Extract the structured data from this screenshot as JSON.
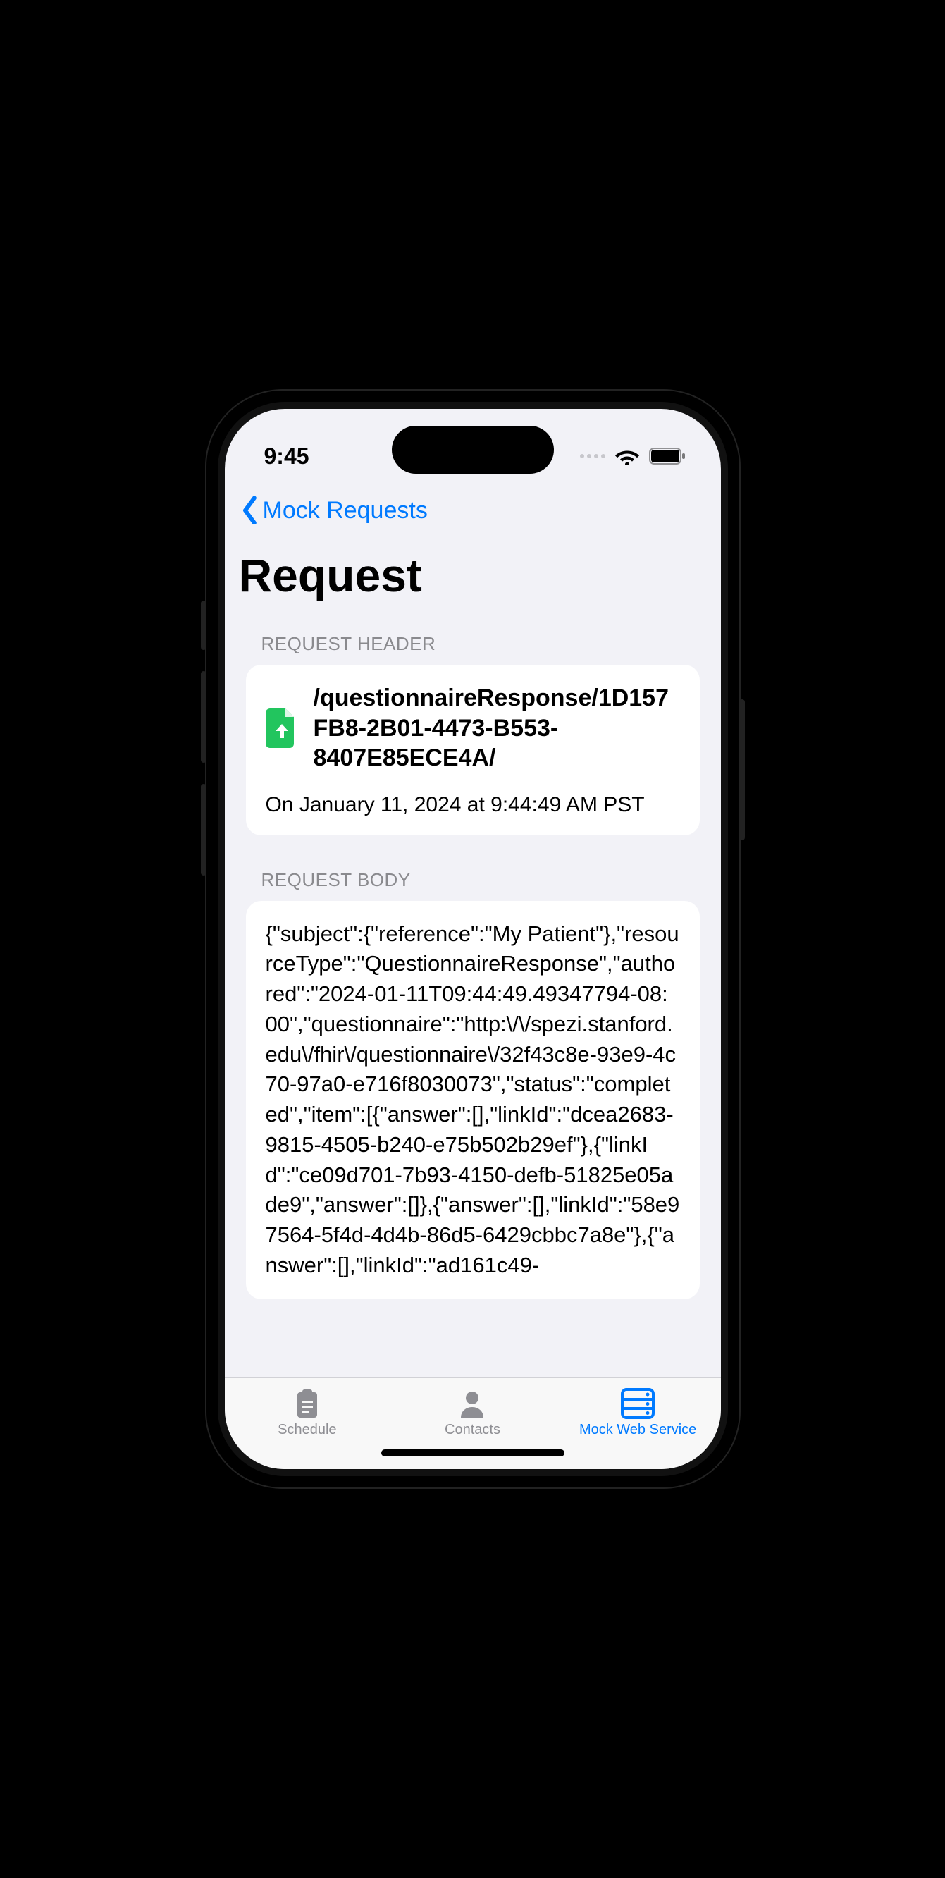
{
  "status": {
    "time": "9:45"
  },
  "nav": {
    "back_label": "Mock Requests"
  },
  "page": {
    "title": "Request"
  },
  "sections": {
    "header_label": "REQUEST HEADER",
    "body_label": "REQUEST BODY"
  },
  "request_header": {
    "path": "/questionnaireResponse/1D157FB8-2B01-4473-B553-8407E85ECE4A/",
    "timestamp": "On January 11, 2024 at 9:44:49 AM PST"
  },
  "request_body": {
    "raw": "{\"subject\":{\"reference\":\"My Patient\"},\"resourceType\":\"QuestionnaireResponse\",\"authored\":\"2024-01-11T09:44:49.49347794-08:00\",\"questionnaire\":\"http:\\/\\/spezi.stanford.edu\\/fhir\\/questionnaire\\/32f43c8e-93e9-4c70-97a0-e716f8030073\",\"status\":\"completed\",\"item\":[{\"answer\":[],\"linkId\":\"dcea2683-9815-4505-b240-e75b502b29ef\"},{\"linkId\":\"ce09d701-7b93-4150-defb-51825e05ade9\",\"answer\":[]},{\"answer\":[],\"linkId\":\"58e97564-5f4d-4d4b-86d5-6429cbbc7a8e\"},{\"answer\":[],\"linkId\":\"ad161c49-"
  },
  "tabs": {
    "schedule": "Schedule",
    "contacts": "Contacts",
    "mock": "Mock Web Service"
  }
}
